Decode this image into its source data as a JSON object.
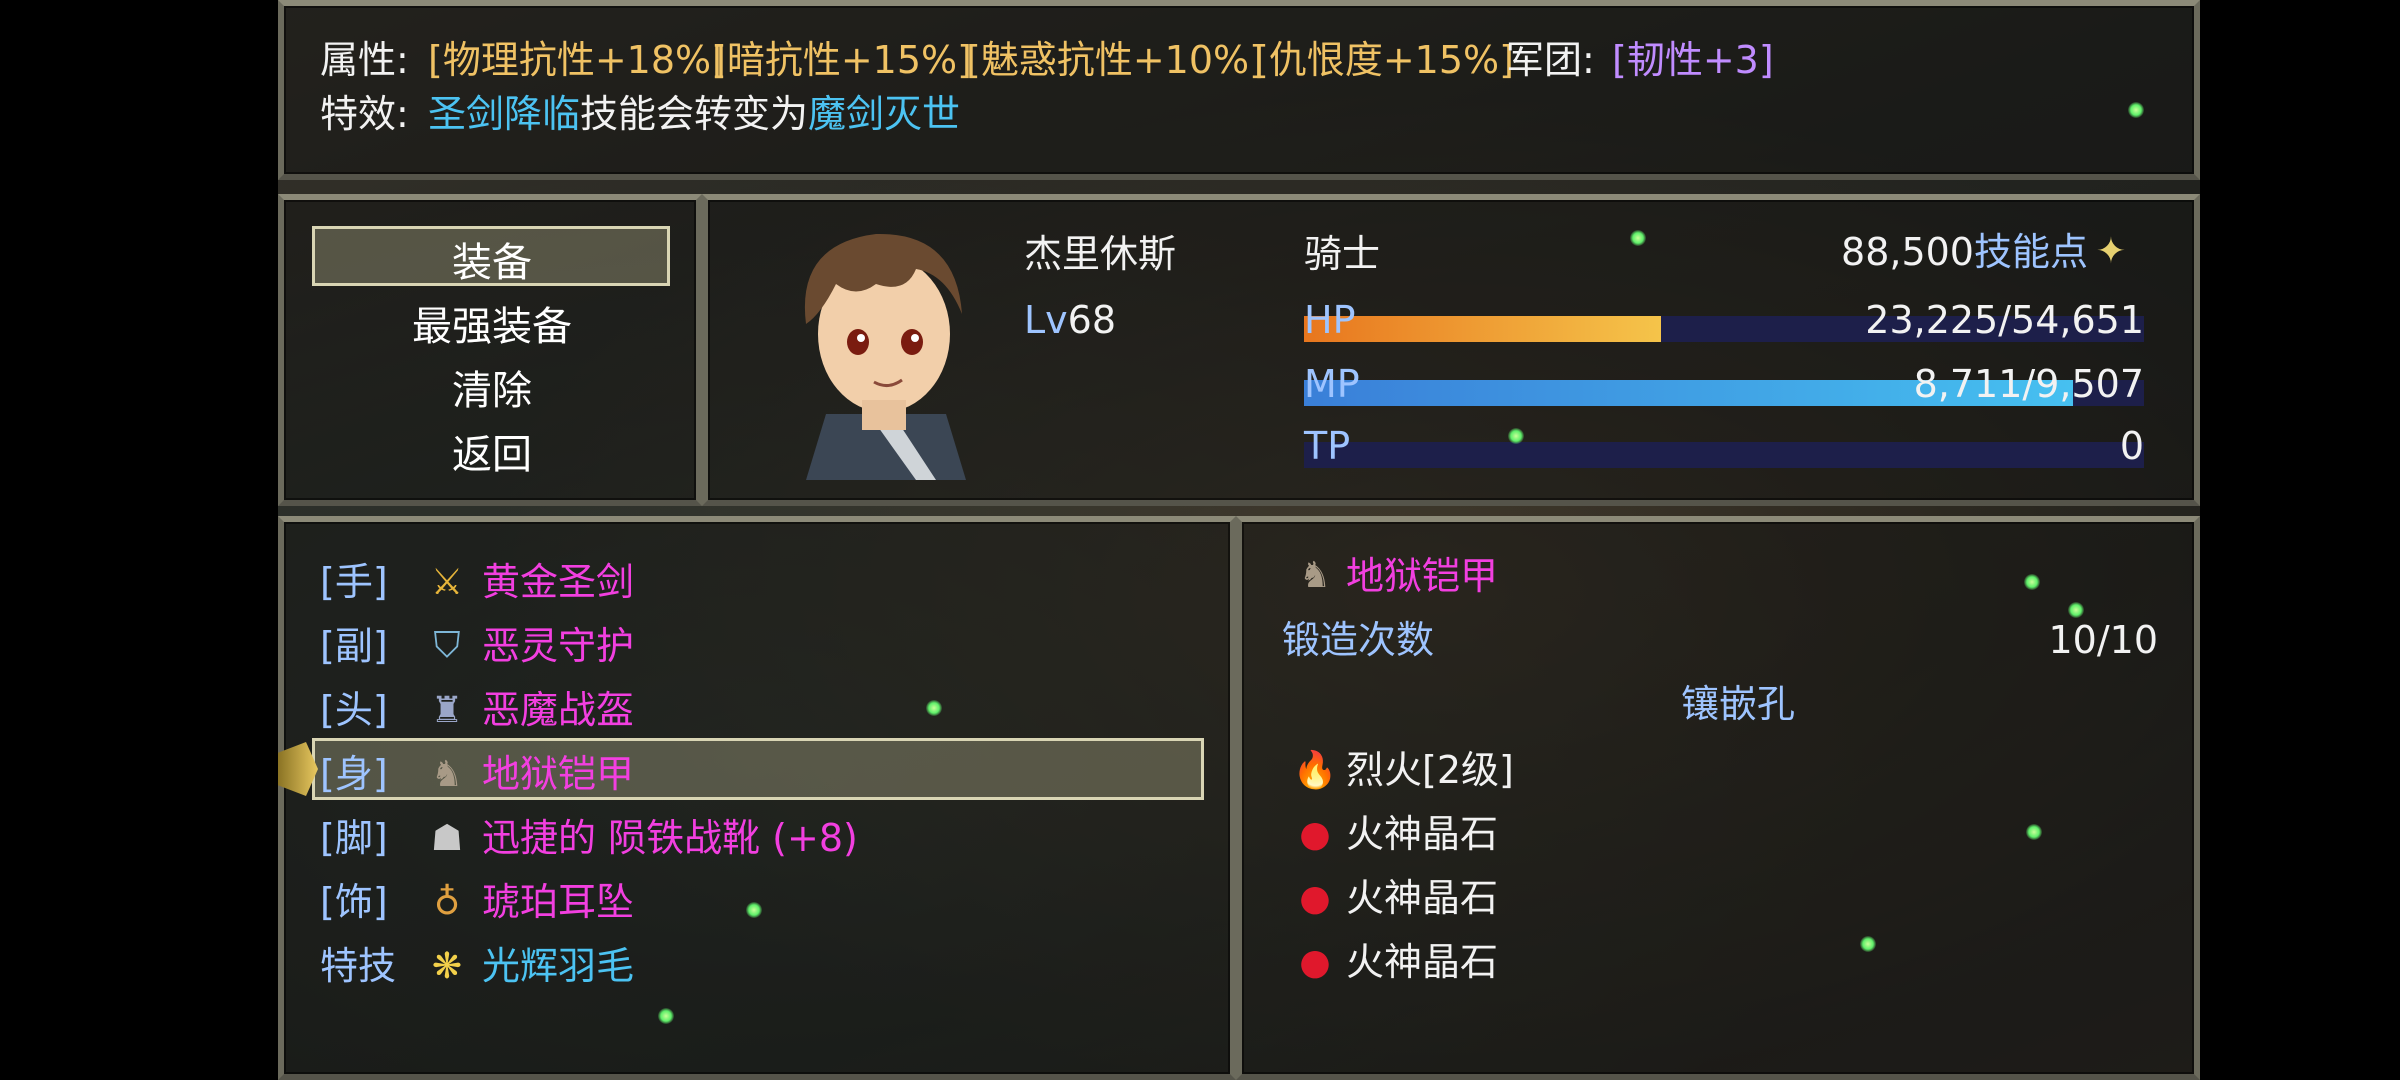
{
  "attributes": {
    "label": "属性:",
    "items": [
      "[物理抗性+18%]",
      "[暗抗性+15%]",
      "[魅惑抗性+10%]",
      "[仇恨度+15%]"
    ],
    "legion_label": "军团:",
    "legion_value": "[韧性+3]"
  },
  "special": {
    "label": "特效:",
    "skill_from": "圣剑降临",
    "middle": "技能会转变为",
    "skill_to": "魔剑灭世"
  },
  "commands": [
    "装备",
    "最强装备",
    "清除",
    "返回"
  ],
  "character": {
    "name": "杰里休斯",
    "level_label": "Lv",
    "level": "68",
    "class": "骑士",
    "skill_points": "88,500",
    "skill_points_label": "技能点",
    "hp_label": "HP",
    "hp_text": "23,225/54,651",
    "hp_fraction": 0.425,
    "mp_label": "MP",
    "mp_text": "8,711/9,507",
    "mp_fraction": 0.916,
    "tp_label": "TP",
    "tp_text": "0",
    "tp_fraction": 0
  },
  "equipment": [
    {
      "slot": "[手]",
      "name": "黄金圣剑",
      "icon": "sword-icon"
    },
    {
      "slot": "[副]",
      "name": "恶灵守护",
      "icon": "shield-icon"
    },
    {
      "slot": "[头]",
      "name": "恶魔战盔",
      "icon": "helmet-icon"
    },
    {
      "slot": "[身]",
      "name": "地狱铠甲",
      "icon": "armor-icon"
    },
    {
      "slot": "[脚]",
      "name": "迅捷的 陨铁战靴 (+8)",
      "icon": "boots-icon"
    },
    {
      "slot": "[饰]",
      "name": "琥珀耳坠",
      "icon": "earring-icon"
    },
    {
      "slot": "特技",
      "name": "光辉羽毛",
      "icon": "feather-icon"
    }
  ],
  "detail": {
    "item_name": "地狱铠甲",
    "forge_label": "锻造次数",
    "forge_value": "10/10",
    "socket_label": "镶嵌孔",
    "sockets": [
      {
        "name": "烈火[2级]",
        "icon": "fire-icon"
      },
      {
        "name": "火神晶石",
        "icon": "red-gem-icon"
      },
      {
        "name": "火神晶石",
        "icon": "red-gem-icon"
      },
      {
        "name": "火神晶石",
        "icon": "red-gem-icon"
      }
    ]
  },
  "colors": {
    "attribute": "#f0c264",
    "legion": "#c08cff",
    "skill_name": "#4cc3f2",
    "item_name": "#f23fe0",
    "system_label": "#9ec4ff",
    "hp_bar": "#f2b840",
    "mp_bar": "#3ab0e8"
  }
}
